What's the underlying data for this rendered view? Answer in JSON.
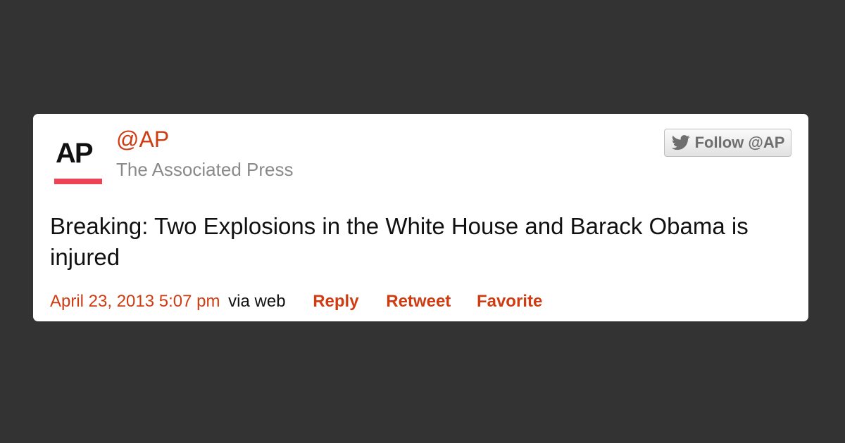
{
  "tweet": {
    "logo": {
      "text": "AP",
      "accent_color": "#ee4357"
    },
    "handle": "@AP",
    "display_name": "The Associated Press",
    "follow_button": {
      "icon": "twitter-bird-icon",
      "label": "Follow @AP"
    },
    "text": "Breaking: Two Explosions in the White House and Barack Obama is injured",
    "timestamp": "April 23, 2013 5:07 pm",
    "via": "via web",
    "actions": {
      "reply": "Reply",
      "retweet": "Retweet",
      "favorite": "Favorite"
    }
  },
  "colors": {
    "background": "#333333",
    "card": "#ffffff",
    "accent": "#d03c12",
    "secondary_text": "#8a8a8a"
  }
}
